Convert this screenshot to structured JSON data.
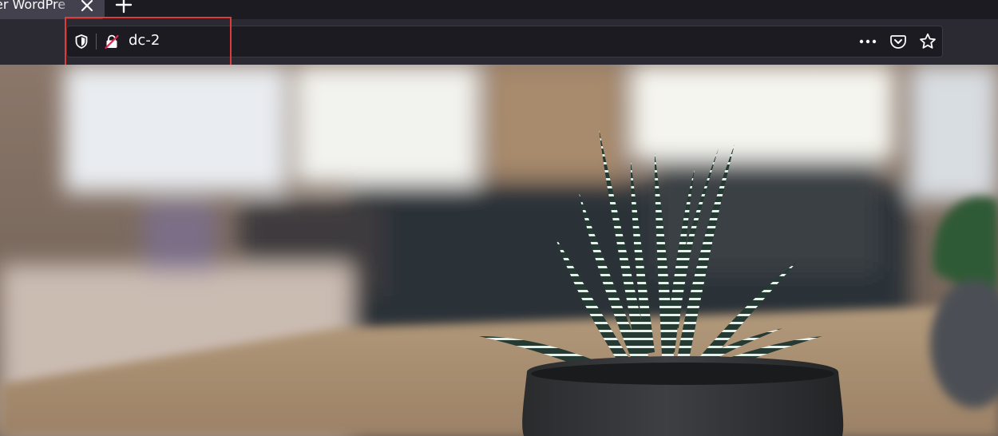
{
  "tab": {
    "title": "er WordPre"
  },
  "navbar": {
    "url": "dc-2"
  },
  "icons": {
    "tab_close": "close-icon",
    "new_tab": "plus-icon",
    "tracking_protection": "shield-icon",
    "connection": "insecure-lock-icon",
    "page_actions": "more-horizontal-icon",
    "pocket": "pocket-icon",
    "bookmark": "star-icon"
  },
  "colors": {
    "annotation": "#e03a3a",
    "toolbar": "#2b2a33",
    "urlbar": "#1c1b22"
  }
}
